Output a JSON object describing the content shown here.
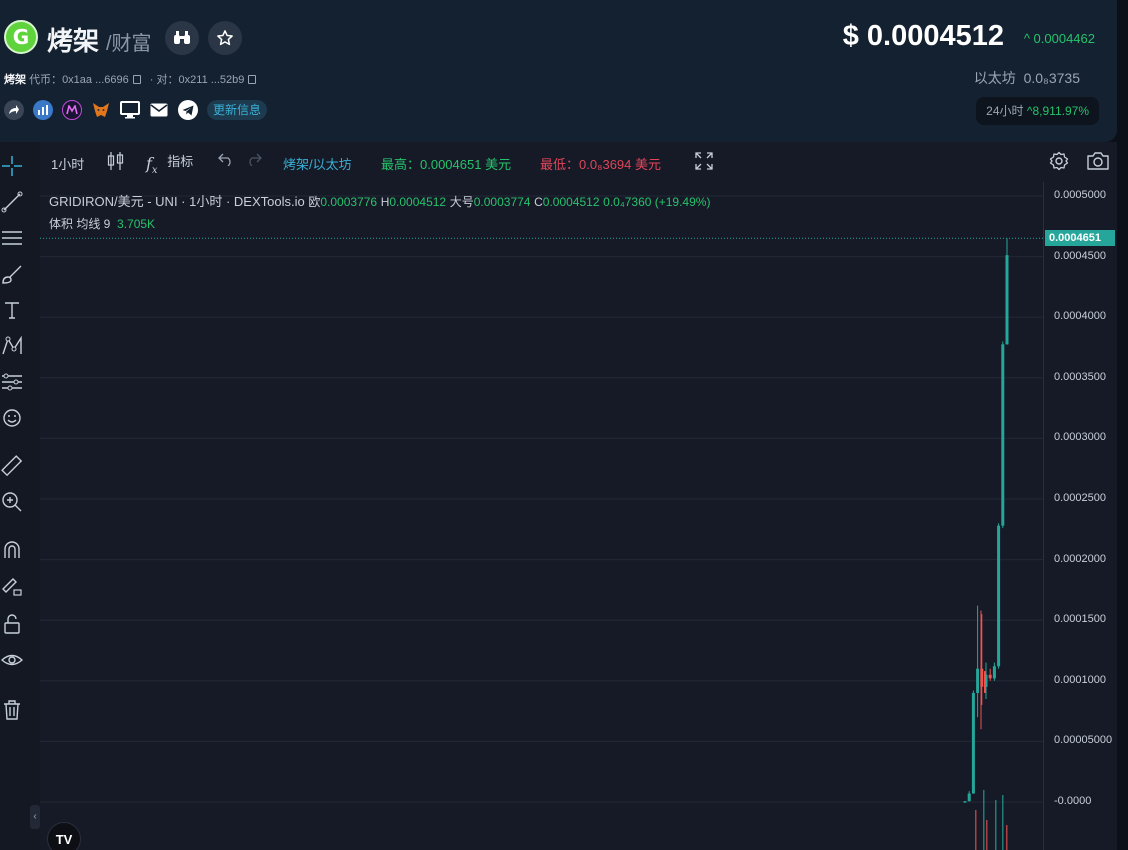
{
  "header": {
    "logo_letter": "G",
    "token_name": "烤架",
    "token_sub": "/财富",
    "symbol_label": "烤架",
    "token_addr_label": "代币：",
    "token_addr": "0x1aa ...6696",
    "pair_addr_label": "· 对：",
    "pair_addr": "0x211 ...52b9",
    "more_info": "更新信息",
    "price_currency": "$",
    "price": "0.0004512",
    "price_change": "0.0004462",
    "eth_label": "以太坊",
    "eth_price": "0.0₈3735",
    "chg24_label": "24小时",
    "chg24_value": "8,911.97%"
  },
  "toolbar": {
    "interval": "1小时",
    "indicators": "指标",
    "pair": "烤架/以太坊",
    "high": "最高：0.0004651 美元",
    "low": "最低：0.0₈3694 美元"
  },
  "legend": {
    "title": "GRIDIRON/美元 - UNI · 1小时 · DEXTools.io",
    "o_key": "欧",
    "o": "0.0003776",
    "h_key": "H",
    "h": "0.0004512",
    "l_key": "大号",
    "l": "0.0003774",
    "c_key": "C",
    "c": "0.0004512",
    "chg": "0.0₄7360 (+19.49%)",
    "vol_label": "体积 均线 9",
    "vol_value": "3.705K"
  },
  "axis": {
    "ticks": [
      "0.0005000",
      "0.0004500",
      "0.0004000",
      "0.0003500",
      "0.0003000",
      "0.0002500",
      "0.0002000",
      "0.0001500",
      "0.0001000",
      "0.00005000",
      "-0.0000"
    ],
    "current": "0.0004651"
  },
  "colors": {
    "up": "#26a69a",
    "down": "#ef5350",
    "accent": "#3ab0d6",
    "green": "#27c26c"
  },
  "icons": {
    "tv_logo": "TV"
  },
  "chart_data": {
    "type": "candlestick",
    "ylim": [
      0,
      0.0005
    ],
    "candles": [
      {
        "o": 6e-07,
        "h": 8e-07,
        "l": 4e-07,
        "c": 7e-07
      },
      {
        "o": 7e-07,
        "h": 9e-06,
        "l": 5e-07,
        "c": 7e-06
      },
      {
        "o": 7e-06,
        "h": 9.2e-05,
        "l": 6.8e-06,
        "c": 9e-05
      },
      {
        "o": 9e-05,
        "h": 0.000162,
        "l": 7e-05,
        "c": 0.00011
      },
      {
        "o": 0.00011,
        "h": 0.000155,
        "l": 8e-05,
        "c": 9.5e-05
      },
      {
        "o": 9.5e-05,
        "h": 0.000115,
        "l": 8.5e-05,
        "c": 0.000105
      },
      {
        "o": 0.000105,
        "h": 0.00011,
        "l": 0.0001,
        "c": 0.000102
      },
      {
        "o": 0.000102,
        "h": 0.000115,
        "l": 0.0001,
        "c": 0.000112
      },
      {
        "o": 0.000112,
        "h": 0.00023,
        "l": 0.00011,
        "c": 0.000228
      },
      {
        "o": 0.000228,
        "h": 0.00038,
        "l": 0.000226,
        "c": 0.0003776
      },
      {
        "o": 0.0003776,
        "h": 0.0004651,
        "l": 0.0003774,
        "c": 0.0004512
      }
    ]
  }
}
